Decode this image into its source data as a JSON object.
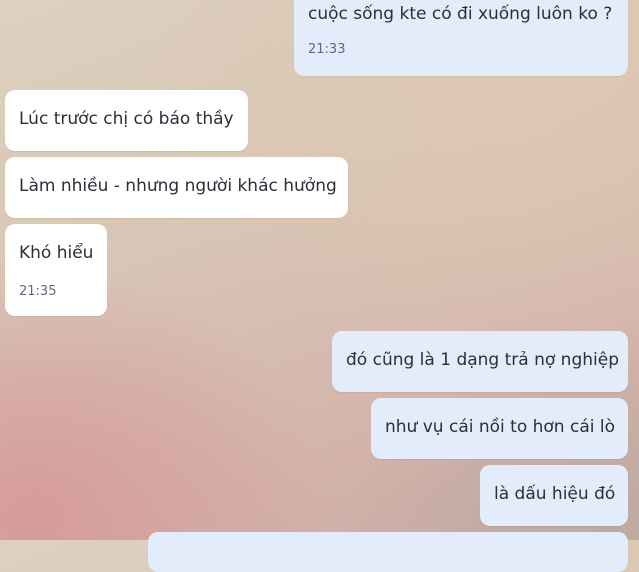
{
  "messages": [
    {
      "side": "out",
      "text": "cuộc sống kte có đi xuống luôn ko ?",
      "time": "21:33"
    },
    {
      "side": "in",
      "text": "Lúc trước chị có báo thầy"
    },
    {
      "side": "in",
      "text": "Làm nhiều - nhưng người khác hưởng"
    },
    {
      "side": "in",
      "text": "Khó hiểu",
      "time": "21:35"
    },
    {
      "side": "out",
      "text": "đó cũng là 1 dạng trả nợ nghiệp"
    },
    {
      "side": "out",
      "text": "như vụ cái nồi to hơn cái lò"
    },
    {
      "side": "out",
      "text": "là dấu hiệu đó"
    },
    {
      "side": "out",
      "text": ""
    }
  ]
}
